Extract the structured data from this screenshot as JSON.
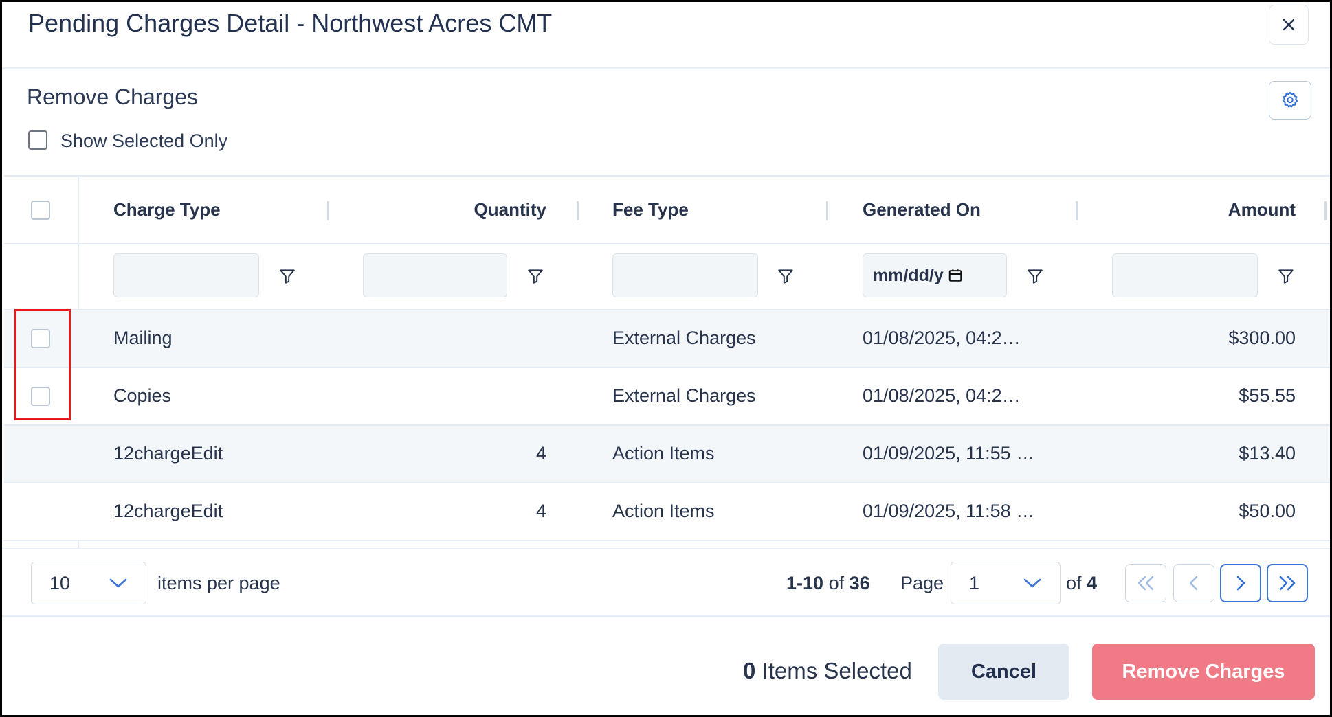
{
  "dialog": {
    "title": "Pending Charges Detail - Northwest Acres CMT",
    "close_icon": "close-icon"
  },
  "section": {
    "title": "Remove Charges",
    "settings_icon": "gear-icon",
    "show_selected_label": "Show Selected Only"
  },
  "table": {
    "columns": [
      {
        "label": "Charge Type"
      },
      {
        "label": "Quantity"
      },
      {
        "label": "Fee Type"
      },
      {
        "label": "Generated On"
      },
      {
        "label": "Amount"
      }
    ],
    "filters": {
      "date_placeholder": "mm/dd/y",
      "filter_icon": "filter-icon"
    },
    "rows": [
      {
        "charge_type": "Mailing",
        "quantity": "",
        "fee_type": "External Charges",
        "generated_on": "01/08/2025, 04:2…",
        "amount": "$300.00",
        "selectable": true
      },
      {
        "charge_type": "Copies",
        "quantity": "",
        "fee_type": "External Charges",
        "generated_on": "01/08/2025, 04:2…",
        "amount": "$55.55",
        "selectable": true
      },
      {
        "charge_type": "12chargeEdit",
        "quantity": "4",
        "fee_type": "Action Items",
        "generated_on": "01/09/2025, 11:55 …",
        "amount": "$13.40",
        "selectable": false
      },
      {
        "charge_type": "12chargeEdit",
        "quantity": "4",
        "fee_type": "Action Items",
        "generated_on": "01/09/2025, 11:58 …",
        "amount": "$50.00",
        "selectable": false
      }
    ]
  },
  "pager": {
    "per_page_value": "10",
    "per_page_label": "items per page",
    "range": "1-10",
    "of_word": "of",
    "total": "36",
    "page_label": "Page",
    "page_value": "1",
    "total_pages": "4"
  },
  "footer": {
    "selected_count": "0",
    "selected_label": "Items Selected",
    "cancel_label": "Cancel",
    "remove_label": "Remove Charges"
  },
  "colors": {
    "remove_disabled": "#f07a85",
    "cancel_bg": "#e3eaf2",
    "accent": "#3d74d8",
    "highlight": "#e8191d"
  }
}
